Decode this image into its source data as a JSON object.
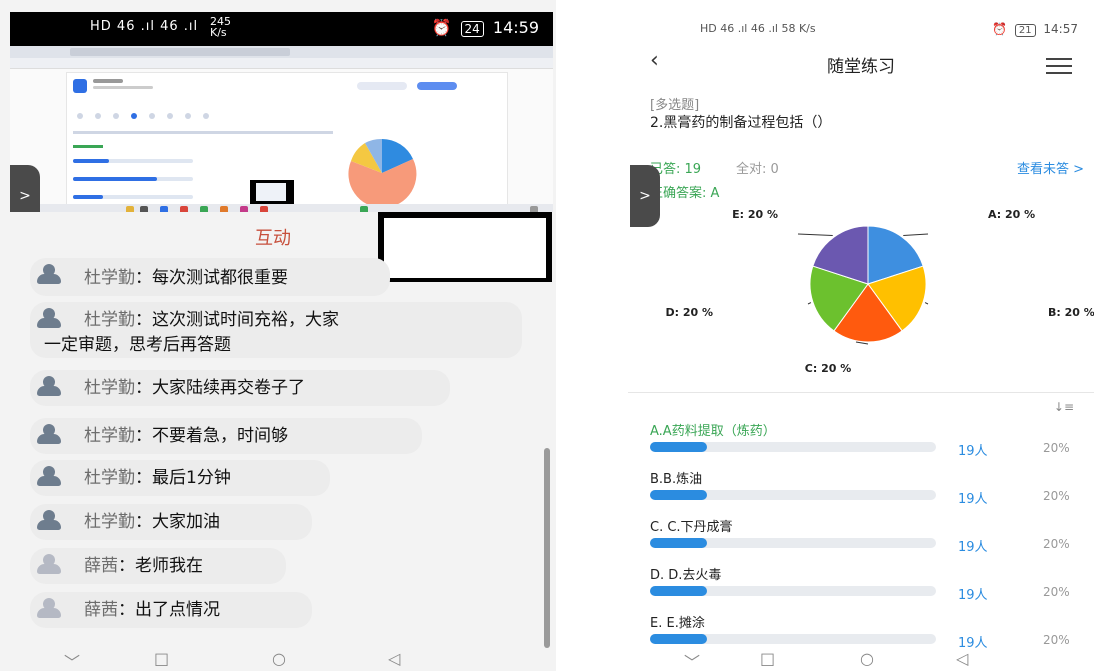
{
  "left": {
    "status": {
      "signal": "HD 46 .ıl 46 .ıl",
      "net_speed": "245",
      "net_unit": "K/s",
      "battery": "24",
      "time": "14:59"
    },
    "panel_title": "互动",
    "side_tab_icon": "chevron-right-icon",
    "messages": [
      {
        "name": "杜学勤",
        "text": "每次测试都很重要"
      },
      {
        "name": "杜学勤",
        "text": "这次测试时间充裕，大家",
        "text2": "一定审题，思考后再答题"
      },
      {
        "name": "杜学勤",
        "text": "大家陆续再交卷子了"
      },
      {
        "name": "杜学勤",
        "text": "不要着急，时间够"
      },
      {
        "name": "杜学勤",
        "text": "最后1分钟"
      },
      {
        "name": "杜学勤",
        "text": "大家加油"
      },
      {
        "name": "薛茜",
        "text": "老师我在"
      },
      {
        "name": "薛茜",
        "text": "出了点情况"
      }
    ],
    "nav": {
      "back": "﹀",
      "home": "□",
      "recent": "○",
      "triangle": "◁"
    }
  },
  "right": {
    "status": {
      "signal": "HD 46 .ıl 46 .ıl",
      "net_speed": "58",
      "net_unit": "K/s",
      "battery": "21",
      "time": "14:57"
    },
    "title": "随堂练习",
    "back_icon": "‹",
    "question_type": "[多选题]",
    "question": "2.黑膏药的制备过程包括（）",
    "answered": "已答: 19",
    "all_correct": "全对: 0",
    "view_unanswered": "查看未答 >",
    "correct_answer": "正确答案: A",
    "colors": {
      "A": "#3e8fe0",
      "B": "#ffc000",
      "C": "#ff5a0e",
      "D": "#6cc12e",
      "E": "#6b58b0",
      "accent": "#2b8ce0",
      "green": "#3aa655"
    },
    "pie": [
      {
        "label": "A: 20 %",
        "value": 20,
        "key": "A"
      },
      {
        "label": "B: 20 %",
        "value": 20,
        "key": "B"
      },
      {
        "label": "C: 20 %",
        "value": 20,
        "key": "C"
      },
      {
        "label": "D: 20 %",
        "value": 20,
        "key": "D"
      },
      {
        "label": "E: 20 %",
        "value": 20,
        "key": "E"
      }
    ],
    "options": [
      {
        "label": "A.A药料提取（炼药）",
        "count": "19人",
        "pct": "20%",
        "fill": 0.2,
        "correct": true
      },
      {
        "label": "B.B.炼油",
        "count": "19人",
        "pct": "20%",
        "fill": 0.2,
        "correct": false
      },
      {
        "label": "C. C.下丹成膏",
        "count": "19人",
        "pct": "20%",
        "fill": 0.2,
        "correct": false
      },
      {
        "label": "D. D.去火毒",
        "count": "19人",
        "pct": "20%",
        "fill": 0.2,
        "correct": false
      },
      {
        "label": "E.  E.摊涂",
        "count": "19人",
        "pct": "20%",
        "fill": 0.2,
        "correct": false
      }
    ],
    "sort_icon": "↓≡",
    "nav": {
      "back": "﹀",
      "home": "□",
      "recent": "○",
      "triangle": "◁"
    }
  }
}
